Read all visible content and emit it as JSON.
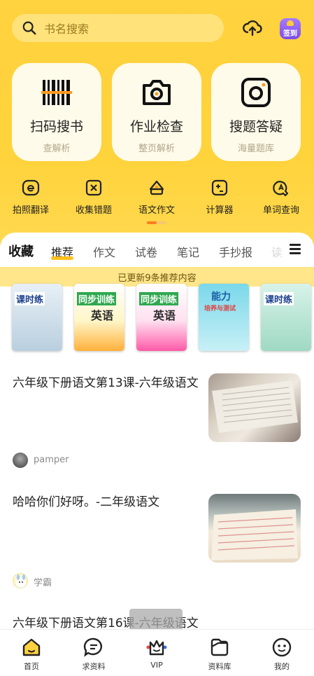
{
  "search": {
    "placeholder": "书名搜索"
  },
  "header": {
    "sign_label": "签到"
  },
  "tools": [
    {
      "title": "扫码搜书",
      "subtitle": "查解析",
      "icon": "barcode-icon"
    },
    {
      "title": "作业检查",
      "subtitle": "整页解析",
      "icon": "camera-icon"
    },
    {
      "title": "搜题答疑",
      "subtitle": "海量题库",
      "icon": "camera-square-icon"
    }
  ],
  "small_tools": [
    {
      "label": "拍照翻译",
      "icon": "translate-icon"
    },
    {
      "label": "收集错题",
      "icon": "wrong-question-icon"
    },
    {
      "label": "语文作文",
      "icon": "essay-icon"
    },
    {
      "label": "计算器",
      "icon": "calculator-icon"
    },
    {
      "label": "单词查询",
      "icon": "word-search-icon"
    }
  ],
  "tabs": {
    "favorites": "收藏",
    "items": [
      "推荐",
      "作文",
      "试卷",
      "笔记",
      "手抄报",
      "读"
    ]
  },
  "notice": "已更新9条推荐内容",
  "books": [
    {
      "title": "课时练"
    },
    {
      "title": "同步训练",
      "sub": "英语"
    },
    {
      "title": "同步训练",
      "sub": "英语"
    },
    {
      "title": "能力",
      "sub": "培养与测试"
    },
    {
      "title": "课时练"
    }
  ],
  "articles": [
    {
      "title": "六年级下册语文第13课-六年级语文",
      "author": "pamper"
    },
    {
      "title": "哈哈你们好呀。-二年级语文",
      "author": "学霸"
    },
    {
      "title": "六年级下册语文第16课-六年级语文"
    }
  ],
  "bottom_nav": [
    {
      "label": "首页",
      "icon": "home-icon",
      "active": true
    },
    {
      "label": "求资料",
      "icon": "chat-icon"
    },
    {
      "label": "VIP",
      "icon": "crown-icon"
    },
    {
      "label": "资料库",
      "icon": "folder-icon"
    },
    {
      "label": "我的",
      "icon": "profile-icon"
    }
  ],
  "colors": {
    "accent": "#ffd23f",
    "active_tab": "#ffc01e",
    "page_indicator": "#ff7d1f"
  }
}
